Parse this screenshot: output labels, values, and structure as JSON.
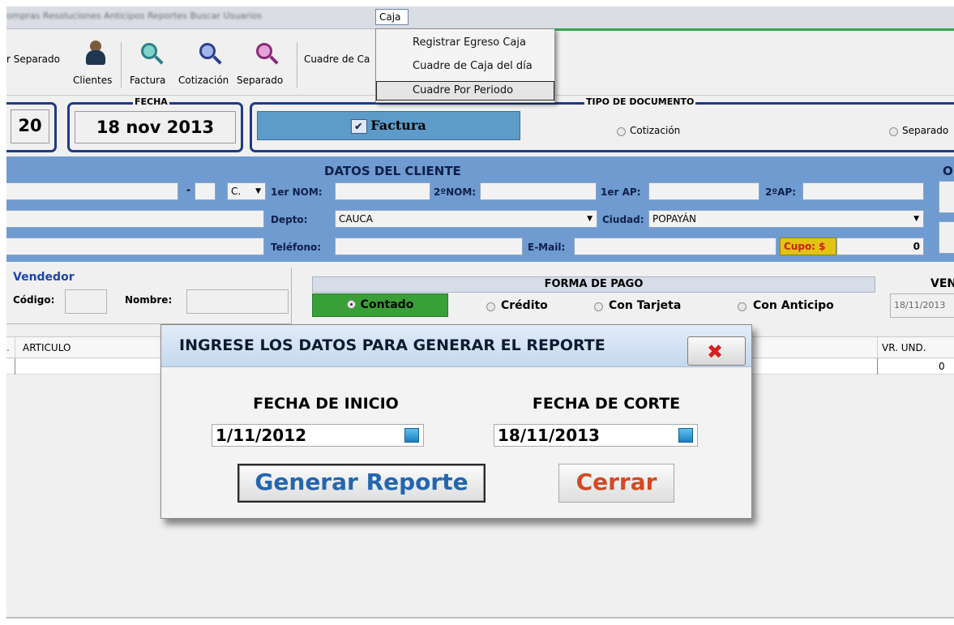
{
  "menubar": {
    "blurred_items": "ompras  Resoluciones  Anticipos  Reportes  Buscar  Usuarios",
    "active_menu": "Caja"
  },
  "caja_menu": {
    "items": [
      "Registrar Egreso Caja",
      "Cuadre de Caja del día",
      "Cuadre Por Periodo"
    ],
    "selected_index": 2
  },
  "toolbar": {
    "separado_left": "r Separado",
    "clientes": "Clientes",
    "factura": "Factura",
    "cotizacion": "Cotización",
    "separado": "Separado",
    "cuadre_caja": "Cuadre de Ca"
  },
  "header": {
    "number_value": "20",
    "fecha_legend": "FECHA",
    "fecha_value": "18 nov 2013",
    "tipo_legend": "TIPO DE DOCUMENTO",
    "factura_label": "Factura",
    "cotizacion_option": "Cotización",
    "separado_option": "Separado"
  },
  "cliente": {
    "title": "DATOS DEL CLIENTE",
    "right_title": "O",
    "doc_type": "C.",
    "dash": "-",
    "nom1_label": "1er NOM:",
    "nom2_label": "2ºNOM:",
    "ap1_label": "1er AP:",
    "ap2_label": "2ºAP:",
    "depto_label": "Depto:",
    "depto_value": "CAUCA",
    "ciudad_label": "Ciudad:",
    "ciudad_value": "POPAYÁN",
    "telefono_label": "Teléfono:",
    "email_label": "E-Mail:",
    "cupo_label": "Cupo: $",
    "cupo_value": "0"
  },
  "vendedor": {
    "title": "Vendedor",
    "codigo_label": "Código:",
    "nombre_label": "Nombre:"
  },
  "forma_pago": {
    "title": "FORMA DE PAGO",
    "contado": "Contado",
    "credito": "Crédito",
    "tarjeta": "Con Tarjeta",
    "anticipo": "Con Anticipo"
  },
  "venc": {
    "title": "VEN",
    "date": "18/11/2013"
  },
  "grid": {
    "col_articulo": "ARTICULO",
    "col_vr_und": "VR. UND.",
    "row_value": "0"
  },
  "modal": {
    "title": "INGRESE LOS DATOS PARA GENERAR EL REPORTE",
    "fecha_inicio_label": "FECHA DE INICIO",
    "fecha_inicio_value": "1/11/2012",
    "fecha_corte_label": "FECHA DE CORTE",
    "fecha_corte_value": "18/11/2013",
    "generar_label": "Generar Reporte",
    "cerrar_label": "Cerrar",
    "close_glyph": "✖"
  }
}
